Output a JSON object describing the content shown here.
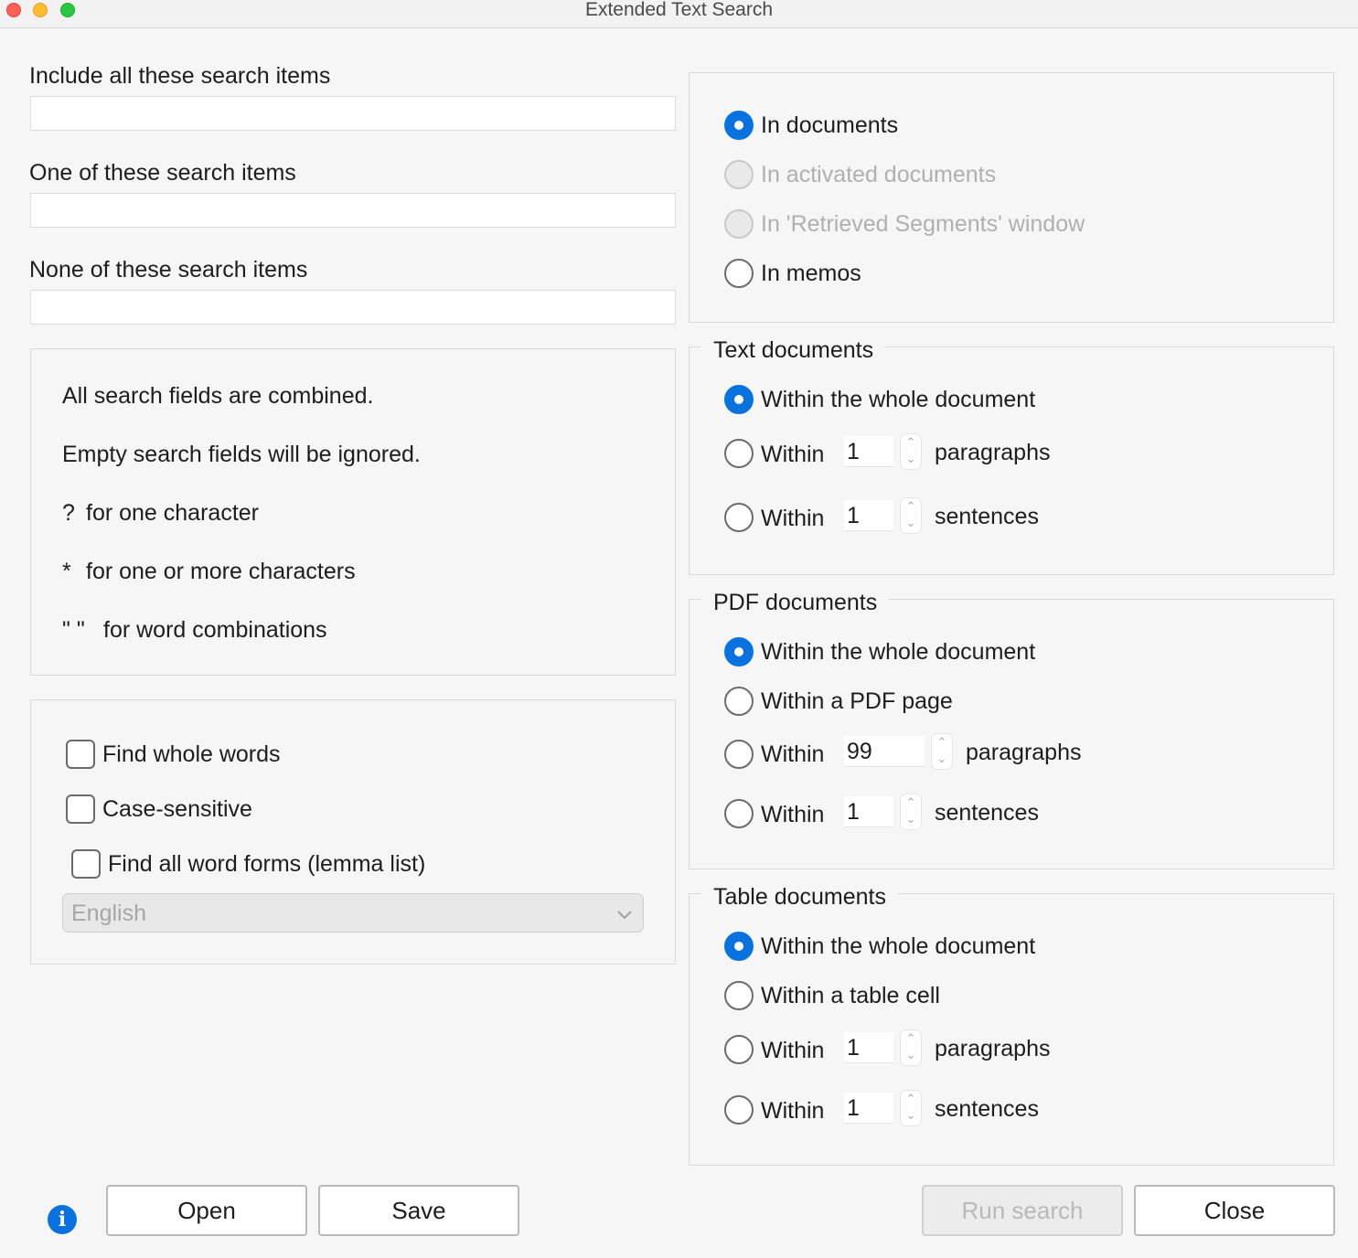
{
  "window": {
    "title": "Extended Text Search"
  },
  "search_fields": {
    "include_label": "Include all these search items",
    "include_value": "",
    "one_of_label": "One of these search items",
    "one_of_value": "",
    "none_label": "None of these search items",
    "none_value": ""
  },
  "help": {
    "line1": "All search fields are combined.",
    "line2": "Empty search fields will be ignored.",
    "q_symbol": "?",
    "q_text": "for one character",
    "star_symbol": "*",
    "star_text": "for one or more characters",
    "quote_symbol": "\" \"",
    "quote_text": "for word combinations"
  },
  "options": {
    "find_whole_words": "Find whole words",
    "case_sensitive": "Case-sensitive",
    "find_all_word_forms": "Find all word forms (lemma list)",
    "language": "English"
  },
  "scope": {
    "in_documents": "In documents",
    "in_activated": "In activated documents",
    "in_retrieved": "In 'Retrieved Segments' window",
    "in_memos": "In memos"
  },
  "text_documents": {
    "title": "Text documents",
    "whole": "Within the whole document",
    "within": "Within",
    "paragraphs_value": "1",
    "paragraphs": "paragraphs",
    "sentences_value": "1",
    "sentences": "sentences"
  },
  "pdf_documents": {
    "title": "PDF documents",
    "whole": "Within the whole document",
    "page": "Within a PDF page",
    "within": "Within",
    "paragraphs_value": "99",
    "paragraphs": "paragraphs",
    "sentences_value": "1",
    "sentences": "sentences"
  },
  "table_documents": {
    "title": "Table documents",
    "whole": "Within the whole document",
    "cell": "Within a table cell",
    "within": "Within",
    "paragraphs_value": "1",
    "paragraphs": "paragraphs",
    "sentences_value": "1",
    "sentences": "sentences"
  },
  "buttons": {
    "open": "Open",
    "save": "Save",
    "run_search": "Run search",
    "close": "Close"
  },
  "colors": {
    "accent": "#0a72df",
    "background": "#f6f6f6"
  }
}
